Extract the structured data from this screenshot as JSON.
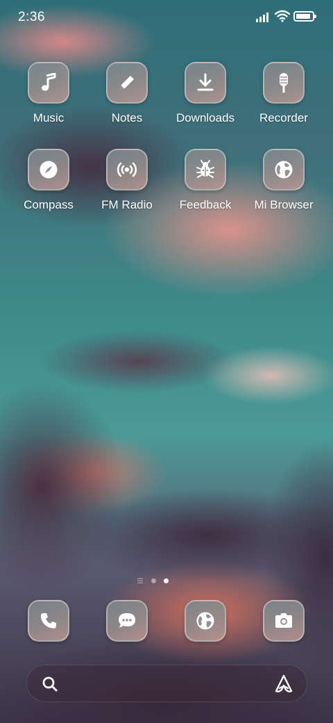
{
  "status_bar": {
    "time": "2:36",
    "icons": [
      "signal-icon",
      "wifi-icon",
      "battery-icon"
    ],
    "battery_level": 0.9
  },
  "apps": [
    {
      "label": "Music",
      "icon": "music-note-icon"
    },
    {
      "label": "Notes",
      "icon": "pencil-icon"
    },
    {
      "label": "Downloads",
      "icon": "download-icon"
    },
    {
      "label": "Recorder",
      "icon": "microphone-icon"
    },
    {
      "label": "Compass",
      "icon": "compass-icon"
    },
    {
      "label": "FM Radio",
      "icon": "radio-icon"
    },
    {
      "label": "Feedback",
      "icon": "bug-icon"
    },
    {
      "label": "Mi Browser",
      "icon": "globe-icon"
    }
  ],
  "page_indicator": {
    "pages": 2,
    "current": 2
  },
  "dock": [
    {
      "icon": "phone-icon"
    },
    {
      "icon": "chat-bubble-icon"
    },
    {
      "icon": "globe-icon"
    },
    {
      "icon": "camera-icon"
    }
  ],
  "search_bar": {
    "icons": [
      "search-icon",
      "assistant-icon"
    ]
  },
  "colors": {
    "text": "#ffffff",
    "tile_top": "#78878c",
    "tile_bottom": "#b99691"
  }
}
